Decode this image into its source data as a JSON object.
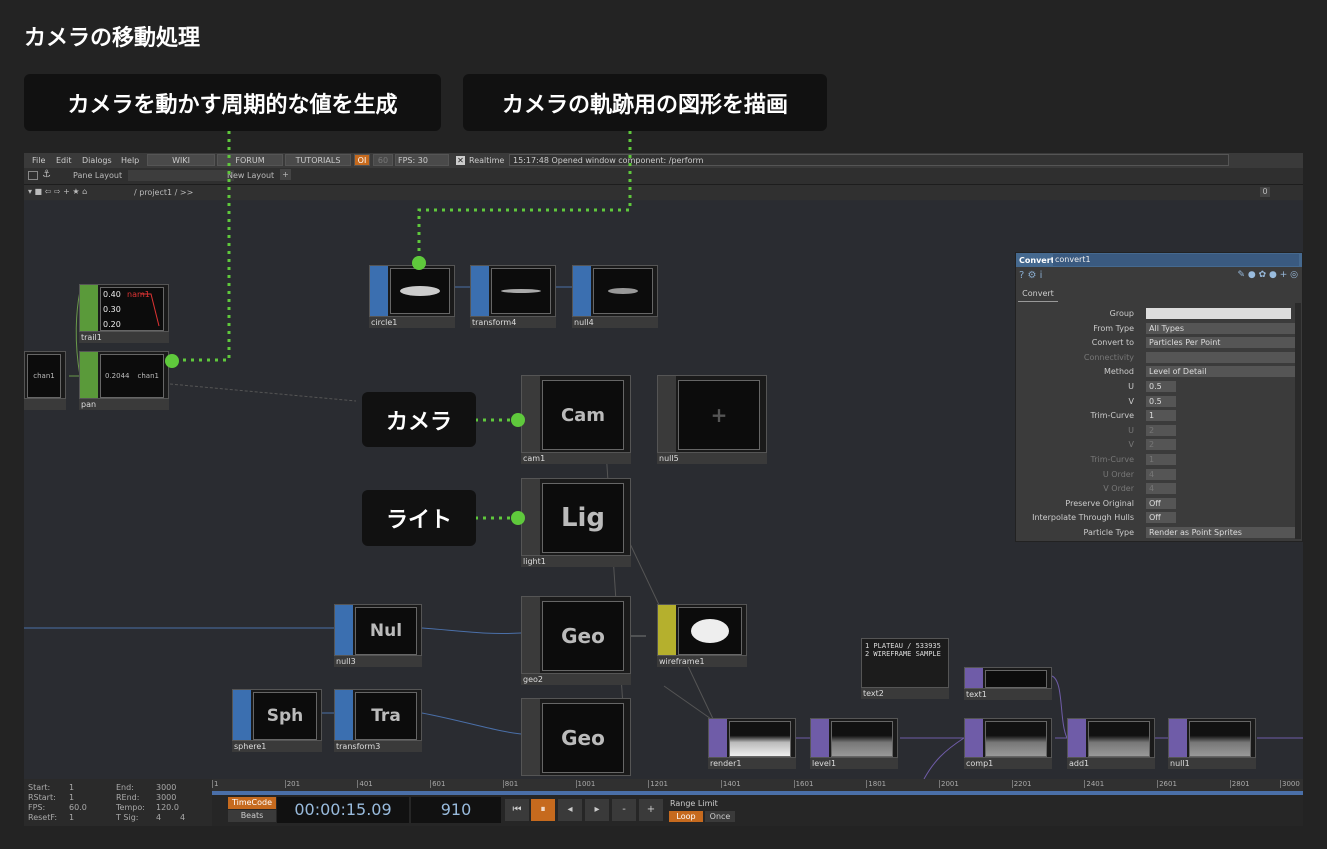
{
  "page_title": "カメラの移動処理",
  "callouts": {
    "top_left": "カメラを動かす周期的な値を生成",
    "top_right": "カメラの軌跡用の図形を描画",
    "camera": "カメラ",
    "light": "ライト"
  },
  "menu": {
    "file": "File",
    "edit": "Edit",
    "dialogs": "Dialogs",
    "help": "Help",
    "wiki": "WIKI",
    "forum": "FORUM",
    "tutorials": "TUTORIALS",
    "oi": "OI",
    "fps_label": "60",
    "fps": "FPS:  30",
    "realtime": "Realtime",
    "status": "15:17:48 Opened window component: /perform"
  },
  "pane_bar": {
    "pane_layout": "Pane Layout",
    "new_layout": "New Layout",
    "plus": "+"
  },
  "path_bar": {
    "path": "/ project1 / >>",
    "zero": "0"
  },
  "nodes": {
    "circle1": "circle1",
    "transform4": "transform4",
    "null4": "null4",
    "trail1": "trail1",
    "trail_values": [
      "0.40",
      "0.30",
      "0.20"
    ],
    "trail_tag": "nam1",
    "chan1_left": "chan1",
    "pan": "pan",
    "pan_value": "0.2044",
    "pan_chan": "chan1",
    "cam1": "cam1",
    "cam_text": "Cam",
    "null5": "null5",
    "light1": "light1",
    "light_text": "Lig",
    "null3": "null3",
    "null_text": "Nul",
    "geo2": "geo2",
    "geo_text": "Geo",
    "wireframe1": "wireframe1",
    "sphere1": "sphere1",
    "sph_text": "Sph",
    "transform3": "transform3",
    "tra_text": "Tra",
    "geo_bottom_text": "Geo",
    "text2": "text2",
    "text2_lines": [
      "1  PLATEAU / 533935",
      "2  WIREFRAME SAMPLE"
    ],
    "text1": "text1",
    "render1": "render1",
    "level1": "level1",
    "comp1": "comp1",
    "add1": "add1",
    "null1": "null1"
  },
  "param_panel": {
    "op_type": "Convert",
    "op_name": "convert1",
    "tab": "Convert",
    "rows": [
      {
        "label": "Group",
        "value": ""
      },
      {
        "label": "From Type",
        "value": "All Types"
      },
      {
        "label": "Convert to",
        "value": "Particles Per Point"
      },
      {
        "label": "Connectivity",
        "value": ""
      },
      {
        "label": "Method",
        "value": "Level of Detail"
      },
      {
        "label": "U",
        "value": "0.5"
      },
      {
        "label": "V",
        "value": "0.5"
      },
      {
        "label": "Trim-Curve",
        "value": "1"
      },
      {
        "label": "U",
        "value": "2"
      },
      {
        "label": "V",
        "value": "2"
      },
      {
        "label": "Trim-Curve",
        "value": "1"
      },
      {
        "label": "U Order",
        "value": "4"
      },
      {
        "label": "V Order",
        "value": "4"
      },
      {
        "label": "Preserve Original",
        "value": "Off"
      },
      {
        "label": "Interpolate Through Hulls",
        "value": "Off"
      },
      {
        "label": "Particle Type",
        "value": "Render as Point Sprites"
      }
    ]
  },
  "timeline": {
    "start_l": "Start:",
    "start": "1",
    "end_l": "End:",
    "end": "3000",
    "rstart_l": "RStart:",
    "rstart": "1",
    "rend_l": "REnd:",
    "rend": "3000",
    "fps_l": "FPS:",
    "fps": "60.0",
    "tempo_l": "Tempo:",
    "tempo": "120.0",
    "resetf_l": "ResetF:",
    "resetf": "1",
    "tsig_l": "T Sig:",
    "tsig_a": "4",
    "tsig_b": "4",
    "ticks": [
      "1",
      "201",
      "401",
      "601",
      "801",
      "1001",
      "1201",
      "1401",
      "1601",
      "1801",
      "2001",
      "2201",
      "2401",
      "2601",
      "2801",
      "3000"
    ],
    "timecode_btn": "TimeCode",
    "beats_btn": "Beats",
    "timecode": "00:00:15.09",
    "frame": "910",
    "range_limit": "Range Limit",
    "loop": "Loop",
    "once": "Once",
    "minus": "-",
    "plus": "+"
  },
  "colors": {
    "green_dots": "#5fc93c",
    "sop_blue": "#3b6fb0",
    "chop_green": "#5a9a3a",
    "mat_yellow": "#b5b02d",
    "top_purple": "#6f5ca8",
    "panel_header": "#45698f",
    "orange": "#e38b2e"
  }
}
